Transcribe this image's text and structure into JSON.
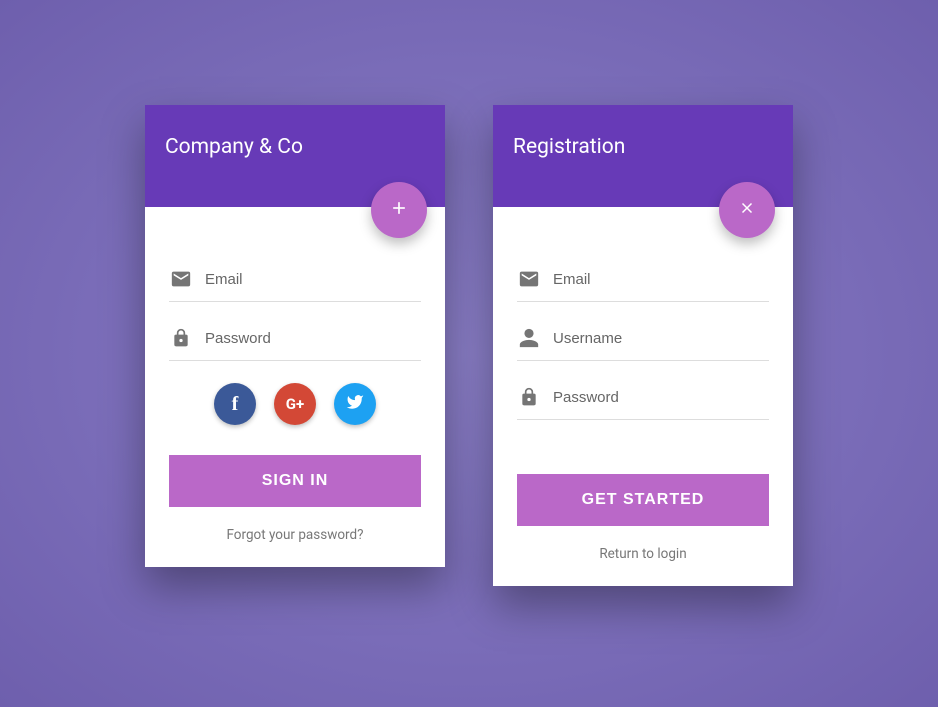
{
  "login": {
    "title": "Company & Co",
    "email_placeholder": "Email",
    "password_placeholder": "Password",
    "submit_label": "SIGN IN",
    "forgot_label": "Forgot your password?",
    "social": {
      "facebook": "f",
      "google": "G+",
      "twitter": "t"
    }
  },
  "register": {
    "title": "Registration",
    "email_placeholder": "Email",
    "username_placeholder": "Username",
    "password_placeholder": "Password",
    "submit_label": "GET STARTED",
    "return_label": "Return to login"
  }
}
